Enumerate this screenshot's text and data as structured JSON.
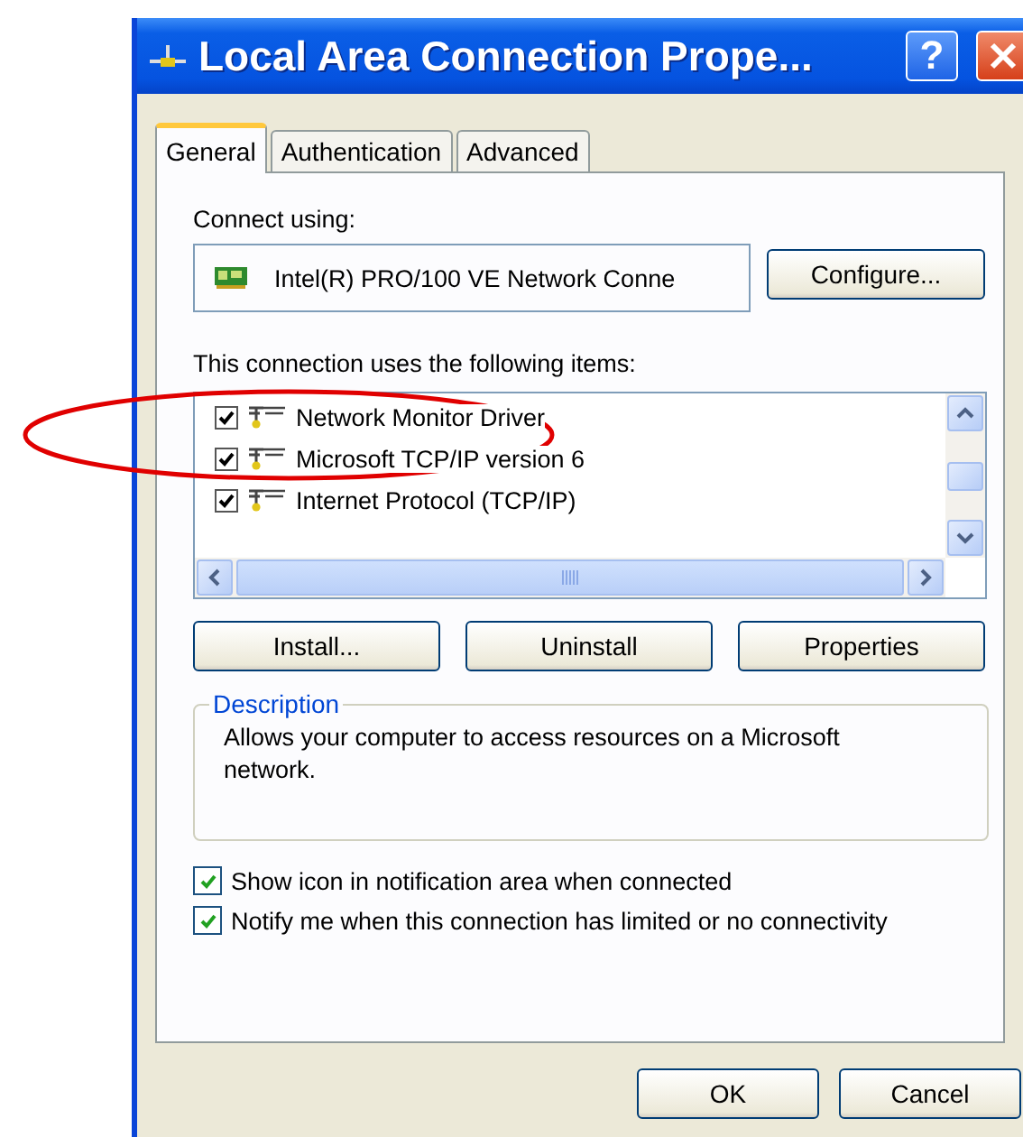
{
  "window": {
    "title": "Local Area Connection Prope...",
    "help_button": "?"
  },
  "tabs": [
    {
      "label": "General",
      "selected": true
    },
    {
      "label": "Authentication",
      "selected": false
    },
    {
      "label": "Advanced",
      "selected": false
    }
  ],
  "connect_using": {
    "label": "Connect using:",
    "adapter": "Intel(R) PRO/100 VE Network Conne",
    "button": "Configure..."
  },
  "items_label": "This connection uses the following items:",
  "items": [
    {
      "label": "Network Monitor Driver",
      "checked": true
    },
    {
      "label": "Microsoft TCP/IP version 6",
      "checked": true
    },
    {
      "label": "Internet Protocol (TCP/IP)",
      "checked": true
    }
  ],
  "item_buttons": [
    "Install...",
    "Uninstall",
    "Properties"
  ],
  "description": {
    "title": "Description",
    "text": "Allows your computer to access resources on a Microsoft network."
  },
  "options": [
    {
      "label": "Show icon in notification area when connected",
      "checked": true
    },
    {
      "label": "Notify me when this connection has limited or no connectivity",
      "checked": true
    }
  ],
  "dialog_buttons": [
    "OK",
    "Cancel"
  ]
}
